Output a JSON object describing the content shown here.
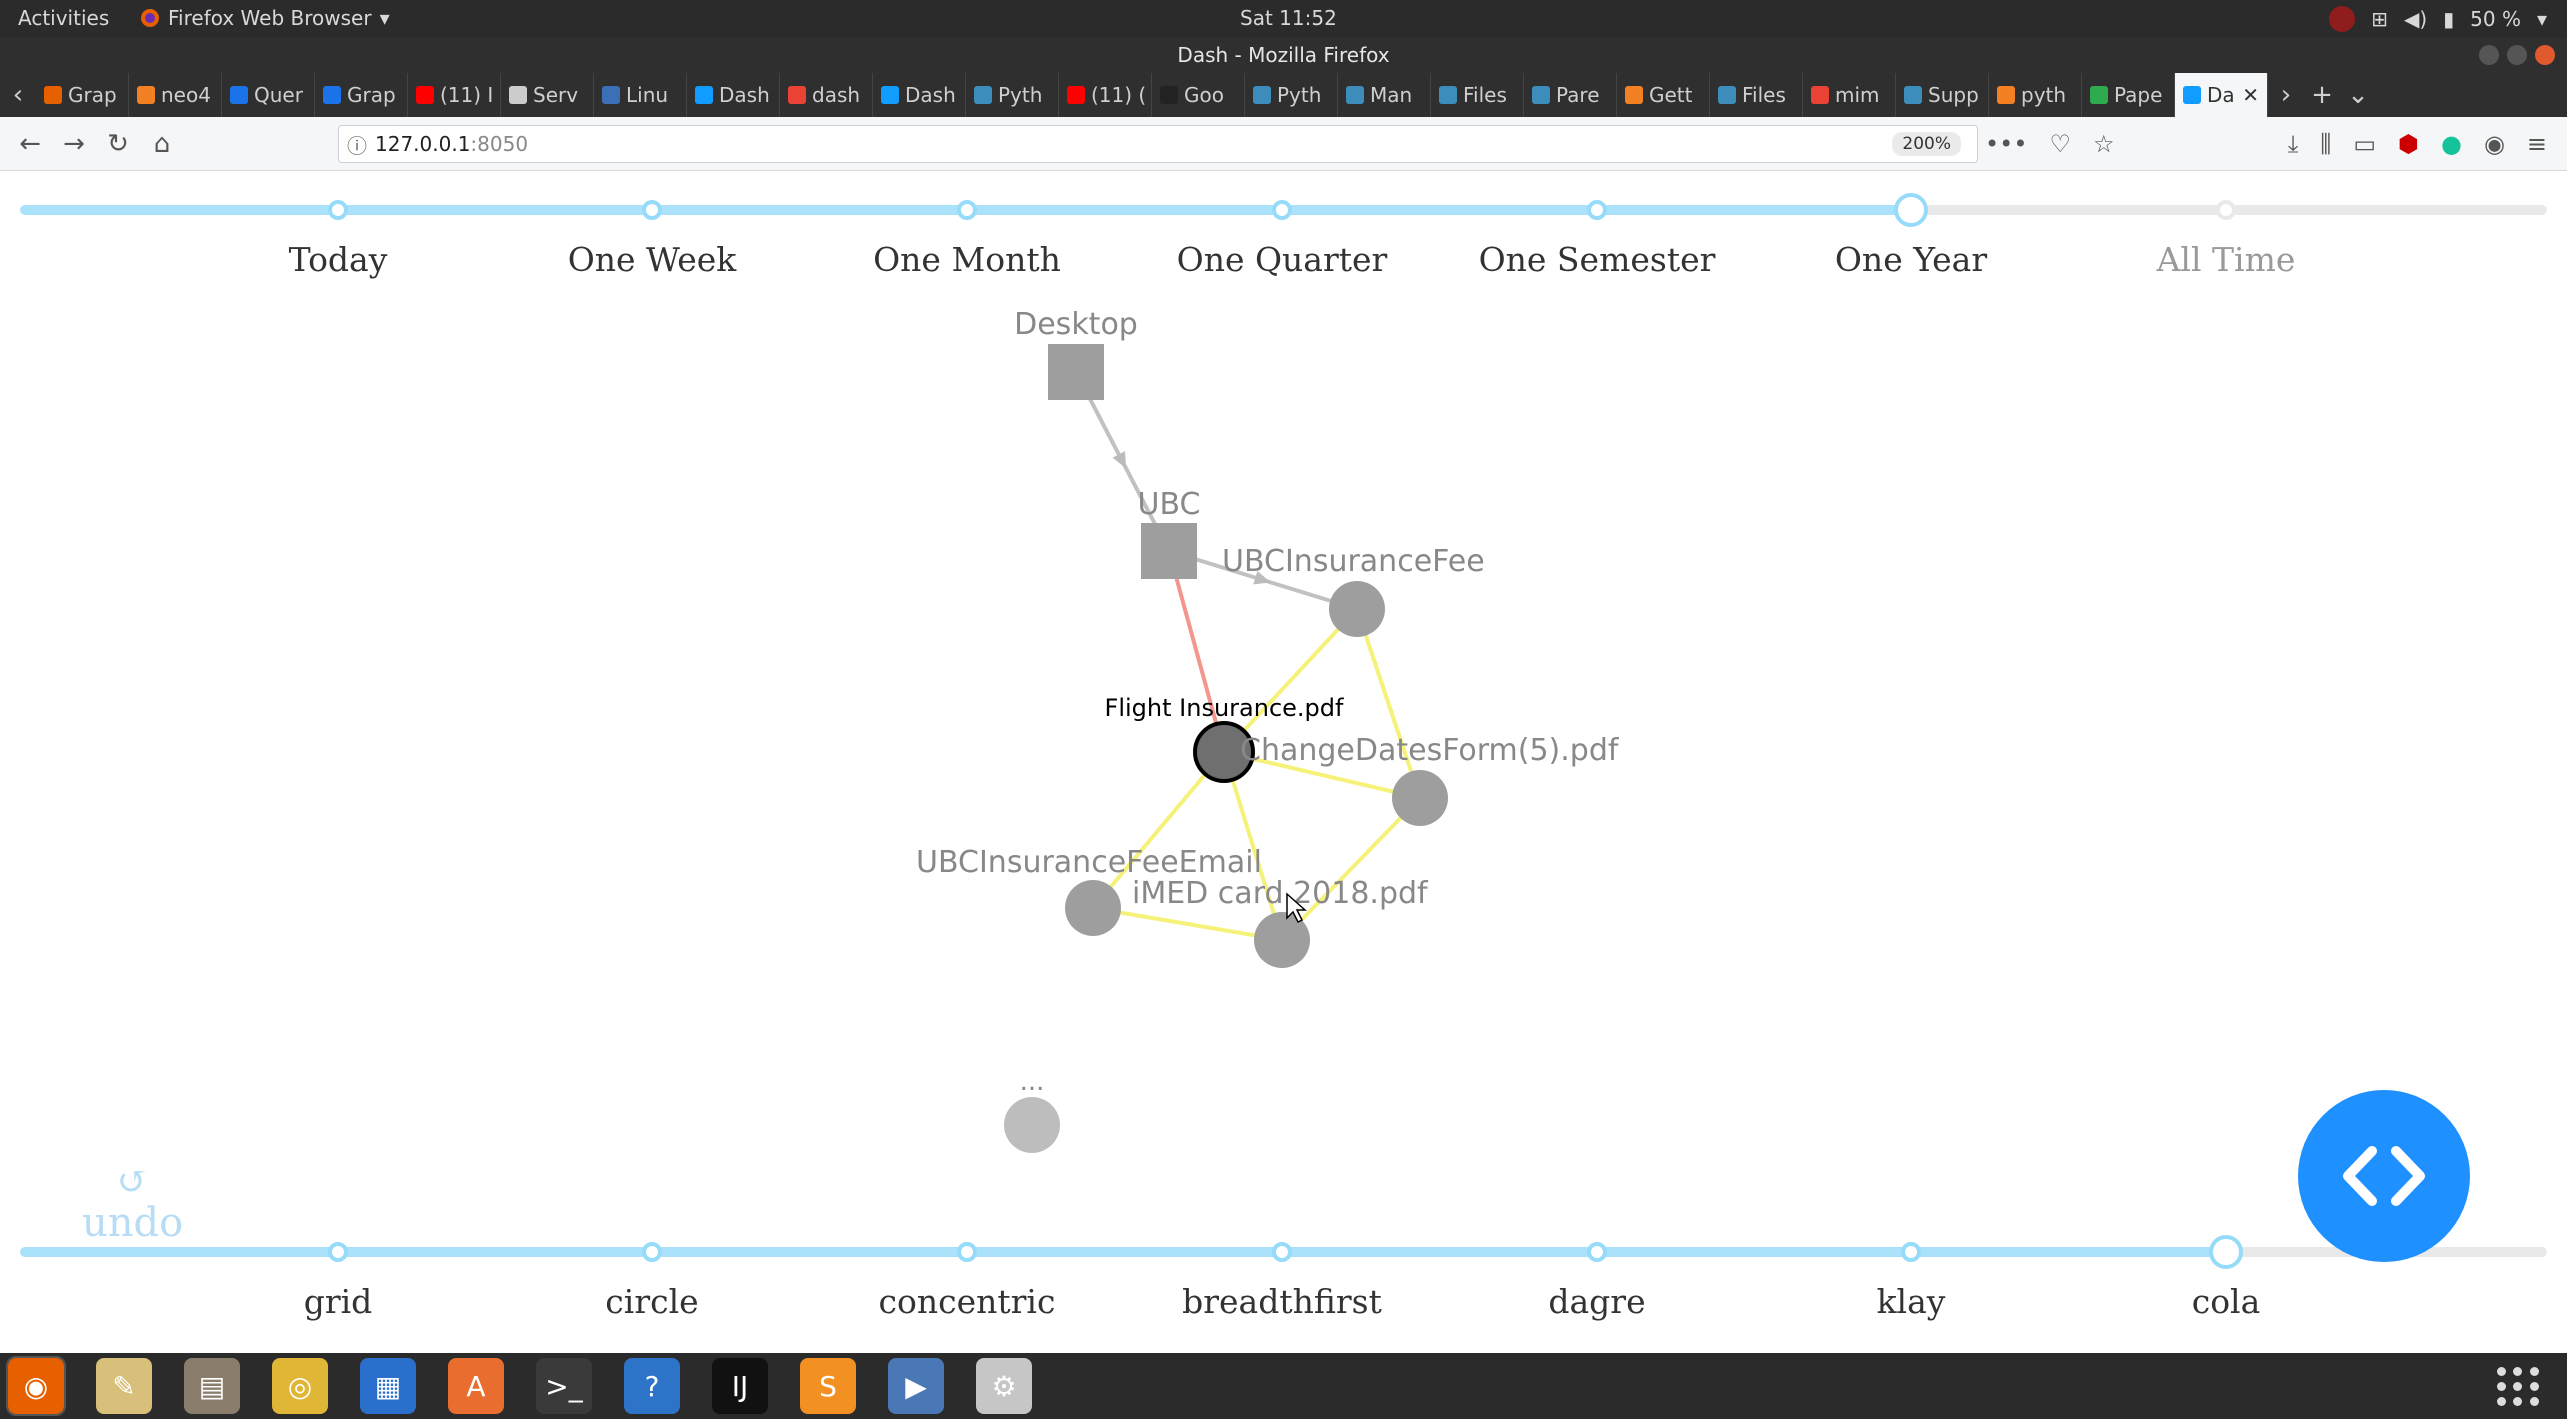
{
  "os_bar": {
    "activities": "Activities",
    "app_name": "Firefox Web Browser",
    "clock": "Sat 11:52",
    "battery": "50 %"
  },
  "window": {
    "title": "Dash - Mozilla Firefox"
  },
  "tabs": [
    {
      "label": "Grap",
      "color": "#e66000"
    },
    {
      "label": "neo4",
      "color": "#f48024"
    },
    {
      "label": "Quer",
      "color": "#1a73e8"
    },
    {
      "label": "Grap",
      "color": "#1a73e8"
    },
    {
      "label": "(11) I",
      "color": "#ff0000"
    },
    {
      "label": "Serv",
      "color": "#cccccc"
    },
    {
      "label": "Linu",
      "color": "#3b6fb6"
    },
    {
      "label": "Dash",
      "color": "#119dff"
    },
    {
      "label": "dash",
      "color": "#ea4335"
    },
    {
      "label": "Dash",
      "color": "#119dff"
    },
    {
      "label": "Pyth",
      "color": "#3c8dbc"
    },
    {
      "label": "(11) (",
      "color": "#ff0000"
    },
    {
      "label": "Goo",
      "color": "#222222"
    },
    {
      "label": "Pyth",
      "color": "#3c8dbc"
    },
    {
      "label": "Man",
      "color": "#3c8dbc"
    },
    {
      "label": "Files",
      "color": "#3c8dbc"
    },
    {
      "label": "Pare",
      "color": "#3c8dbc"
    },
    {
      "label": "Gett",
      "color": "#f48024"
    },
    {
      "label": "Files",
      "color": "#3c8dbc"
    },
    {
      "label": "mim",
      "color": "#ea4335"
    },
    {
      "label": "Supp",
      "color": "#3c8dbc"
    },
    {
      "label": "pyth",
      "color": "#f48024"
    },
    {
      "label": "Pape",
      "color": "#2eaa4f"
    },
    {
      "label": "Da",
      "color": "#119dff",
      "active": true
    }
  ],
  "nav": {
    "url_host": "127.0.0.1",
    "url_port": ":8050",
    "zoom": "200%"
  },
  "time_slider": {
    "labels": [
      "Today",
      "One Week",
      "One Month",
      "One Quarter",
      "One Semester",
      "One Year",
      "All Time"
    ],
    "selected_index": 5
  },
  "layout_slider": {
    "labels": [
      "grid",
      "circle",
      "concentric",
      "breadthfirst",
      "dagre",
      "klay",
      "cola"
    ],
    "selected_index": 6
  },
  "undo": {
    "label": "undo",
    "icon": "undo-icon"
  },
  "graph": {
    "nodes": [
      {
        "id": "desktop",
        "label": "Desktop",
        "shape": "square",
        "color": "#9e9e9e"
      },
      {
        "id": "ubc",
        "label": "UBC",
        "shape": "square",
        "color": "#9e9e9e"
      },
      {
        "id": "fee",
        "label": "UBCInsuranceFee",
        "shape": "circle",
        "color": "#9e9e9e"
      },
      {
        "id": "flight",
        "label": "Flight Insurance.pdf",
        "shape": "circle",
        "color": "#6f6f6f",
        "selected": true
      },
      {
        "id": "change",
        "label": "ChangeDatesForm(5).pdf",
        "shape": "circle",
        "color": "#9e9e9e"
      },
      {
        "id": "email",
        "label": "UBCInsuranceFeeEmail",
        "shape": "circle",
        "color": "#9e9e9e"
      },
      {
        "id": "imed",
        "label": "iMED card 2018.pdf",
        "shape": "circle",
        "color": "#9e9e9e"
      },
      {
        "id": "more",
        "label": "...",
        "shape": "circle",
        "color": "#bdbdbd"
      }
    ],
    "edges": [
      {
        "from": "desktop",
        "to": "ubc",
        "color": "#bbbbbb"
      },
      {
        "from": "ubc",
        "to": "fee",
        "color": "#bbbbbb"
      },
      {
        "from": "ubc",
        "to": "flight",
        "color": "#f28b82"
      },
      {
        "from": "flight",
        "to": "fee",
        "color": "#f5f06b"
      },
      {
        "from": "flight",
        "to": "change",
        "color": "#f5f06b"
      },
      {
        "from": "flight",
        "to": "email",
        "color": "#f5f06b"
      },
      {
        "from": "flight",
        "to": "imed",
        "color": "#f5f06b"
      },
      {
        "from": "fee",
        "to": "change",
        "color": "#f5f06b"
      },
      {
        "from": "change",
        "to": "imed",
        "color": "#f5f06b"
      },
      {
        "from": "email",
        "to": "imed",
        "color": "#f5f06b"
      }
    ]
  },
  "fab": {
    "icon": "code-icon",
    "color": "#1e90ff"
  },
  "taskbar": [
    {
      "icon": "firefox-icon",
      "color": "#e66000"
    },
    {
      "icon": "text-editor-icon",
      "color": "#d8c07a"
    },
    {
      "icon": "files-icon",
      "color": "#8a7d6b"
    },
    {
      "icon": "rhythmbox-icon",
      "color": "#e0b637"
    },
    {
      "icon": "writer-icon",
      "color": "#2a6fcc"
    },
    {
      "icon": "software-icon",
      "color": "#e86d2e"
    },
    {
      "icon": "terminal-icon",
      "color": "#3a3a3a"
    },
    {
      "icon": "help-icon",
      "color": "#2d73c8"
    },
    {
      "icon": "intellij-icon",
      "color": "#111111"
    },
    {
      "icon": "sublime-icon",
      "color": "#f29022"
    },
    {
      "icon": "video-editor-icon",
      "color": "#4a78b6"
    },
    {
      "icon": "settings-icon",
      "color": "#c6c6c6"
    }
  ]
}
